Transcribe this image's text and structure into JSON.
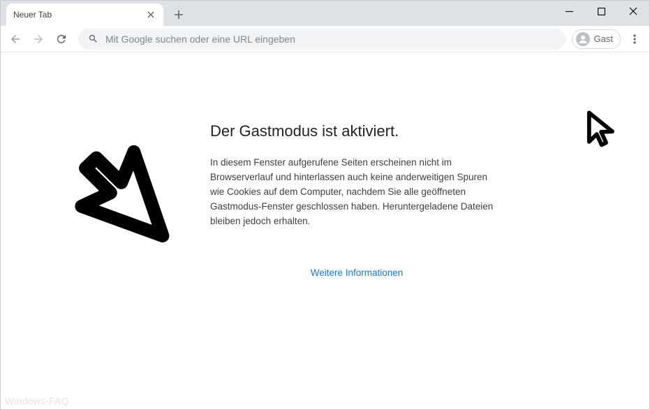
{
  "tab": {
    "title": "Neuer Tab"
  },
  "omnibox": {
    "placeholder": "Mit Google suchen oder eine URL eingeben"
  },
  "profile": {
    "label": "Gast"
  },
  "page": {
    "headline": "Der Gastmodus ist aktiviert.",
    "body": "In diesem Fenster aufgerufene Seiten erscheinen nicht im Browserverlauf und hinterlassen auch keine anderweitigen Spuren wie Cookies auf dem Computer, nachdem Sie alle geöffneten Gastmodus-Fenster geschlossen haben. Heruntergeladene Dateien bleiben jedoch erhalten.",
    "learn_more": "Weitere Informationen"
  },
  "watermark": "Windows-FAQ"
}
